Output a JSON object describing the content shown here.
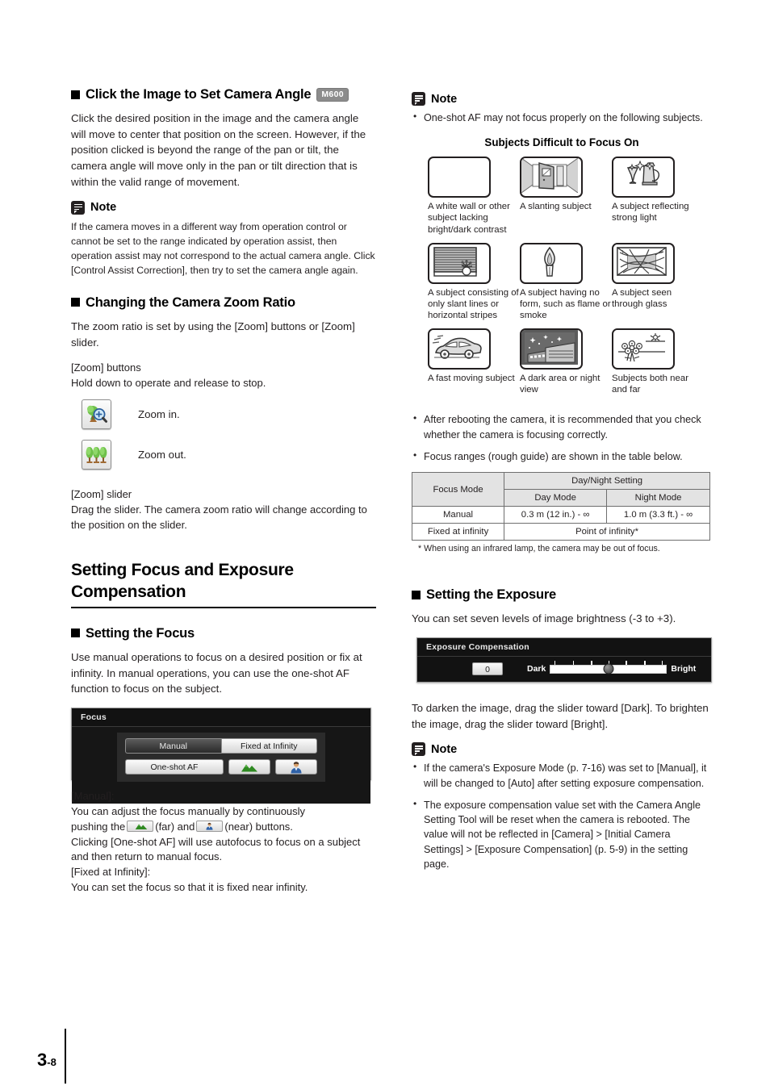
{
  "page": {
    "number_major": "3",
    "number_minor": "-8"
  },
  "left": {
    "s1": {
      "heading": "Click the Image to Set Camera Angle",
      "badge": "M600",
      "body": "Click the desired position in the image and the camera angle will move to center that position on the screen. However, if the position clicked is beyond the range of the pan or tilt, the camera angle will move only in the pan or tilt direction that is within the valid range of movement.",
      "note_title": "Note",
      "note_body": "If the camera moves in a different way from operation control or cannot be set to the range indicated by operation assist, then operation assist may not correspond to the actual camera angle. Click [Control Assist Correction], then try to set the camera angle again."
    },
    "s2": {
      "heading": "Changing the Camera Zoom Ratio",
      "body": "The zoom ratio is set by using the [Zoom] buttons or [Zoom] slider.",
      "buttons_label": "[Zoom] buttons",
      "buttons_desc": "Hold down to operate and release to stop.",
      "zoom_in_caption": "Zoom in.",
      "zoom_out_caption": "Zoom out.",
      "slider_label": "[Zoom] slider",
      "slider_desc": "Drag the slider. The camera zoom ratio will change according to the position on the slider."
    },
    "s3": {
      "title": "Setting Focus and Exposure Compensation",
      "heading": "Setting the Focus",
      "body": "Use manual operations to focus on a desired position or fix at infinity. In manual operations, you can use the one-shot AF function to focus on the subject.",
      "widget": {
        "title": "Focus",
        "tab_manual": "Manual",
        "tab_fixed": "Fixed at Infinity",
        "btn_oneshot": "One-shot AF",
        "btn_far_icon": "mountain-icon",
        "btn_near_icon": "person-icon"
      },
      "manual_label": "[Manual]:",
      "manual_line1": "You can adjust the focus manually by continuously",
      "manual_line2_a": "pushing the",
      "manual_line2_b": "(far) and",
      "manual_line2_c": "(near) buttons.",
      "manual_line3": "Clicking [One-shot AF] will use autofocus to focus on a subject and then return to manual focus.",
      "fixed_label": "[Fixed at Infinity]:",
      "fixed_desc": "You can set the focus so that it is fixed near infinity."
    }
  },
  "right": {
    "note1": {
      "title": "Note",
      "bullets": [
        "One-shot AF may not focus properly on the following subjects."
      ]
    },
    "grid_title": "Subjects Difficult to Focus On",
    "grid": [
      {
        "icon": "blank-white-wall-icon",
        "caption": "A white wall or other subject lacking bright/dark contrast"
      },
      {
        "icon": "slanting-door-icon",
        "caption": "A slanting subject"
      },
      {
        "icon": "reflective-glassware-icon",
        "caption": "A subject reflecting strong light"
      },
      {
        "icon": "striped-blinds-icon",
        "caption": "A subject consisting of only slant lines or horizontal stripes"
      },
      {
        "icon": "flame-icon",
        "caption": "A subject having no form, such as flame or smoke"
      },
      {
        "icon": "through-glass-icon",
        "caption": "A subject seen through glass"
      },
      {
        "icon": "fast-car-icon",
        "caption": "A fast moving subject"
      },
      {
        "icon": "night-view-icon",
        "caption": "A dark area or night view"
      },
      {
        "icon": "near-and-far-icon",
        "caption": "Subjects both near and far"
      }
    ],
    "bullets2": [
      "After rebooting the camera, it is recommended that you check whether the camera is focusing correctly.",
      "Focus ranges (rough guide) are shown in the table below."
    ],
    "table": {
      "col_focus_mode": "Focus Mode",
      "col_daynight": "Day/Night Setting",
      "col_day": "Day Mode",
      "col_night": "Night Mode",
      "rows": [
        {
          "mode": "Manual",
          "day": "0.3 m (12 in.) - ∞",
          "night": "1.0 m (3.3 ft.) - ∞"
        },
        {
          "mode": "Fixed at infinity",
          "span": "Point of infinity*"
        }
      ],
      "footnote": "* When using an infrared lamp, the camera may be out of focus."
    },
    "exposure": {
      "heading": "Setting the Exposure",
      "body": "You can set seven levels of image brightness (-3 to +3).",
      "widget": {
        "title": "Exposure Compensation",
        "value": "0",
        "dark_label": "Dark",
        "bright_label": "Bright"
      },
      "after": "To darken the image, drag the slider toward [Dark]. To brighten the image, drag the slider toward [Bright].",
      "note_title": "Note",
      "note_bullets": [
        "If the camera's Exposure Mode (p. 7-16) was set to [Manual], it will be changed to [Auto] after setting exposure compensation.",
        "The exposure compensation value set with the Camera Angle Setting Tool will be reset when the camera is rebooted. The value will not be reflected in [Camera] > [Initial Camera Settings] > [Exposure Compensation] (p. 5-9) in the setting page."
      ]
    }
  }
}
